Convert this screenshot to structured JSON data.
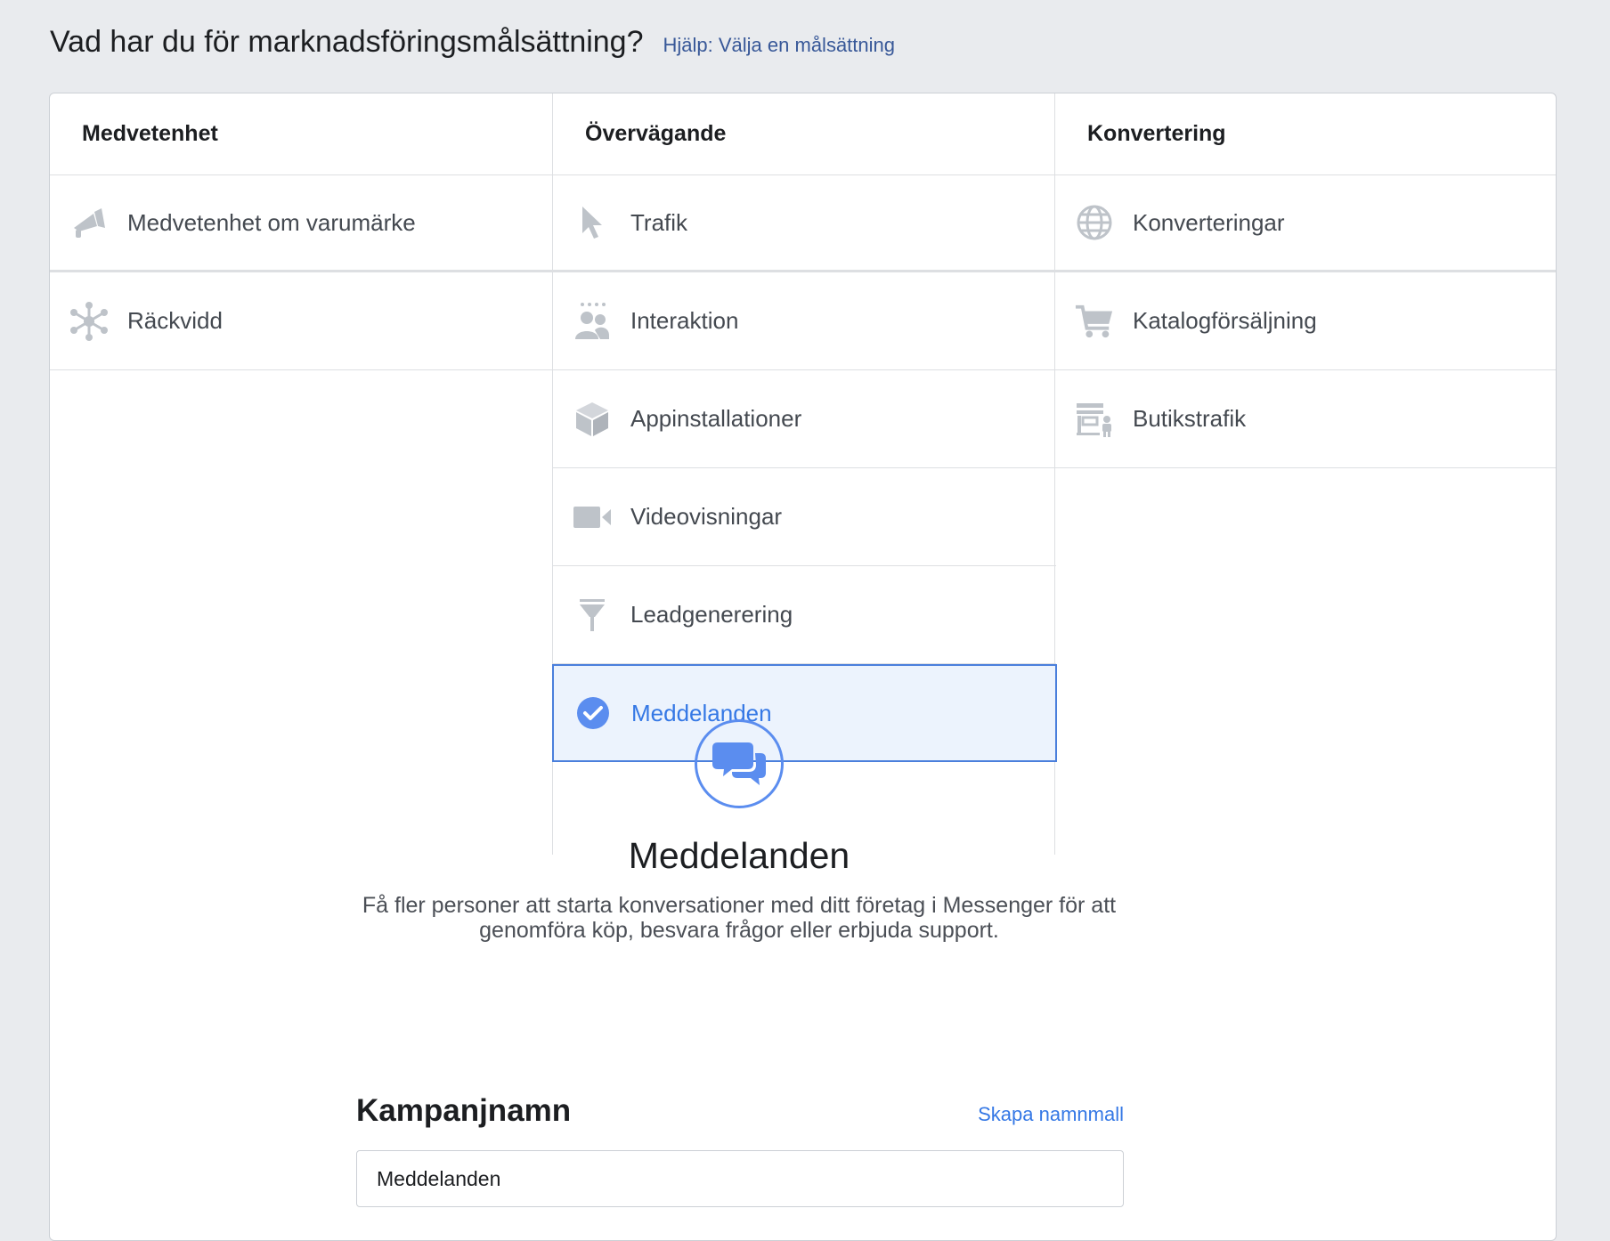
{
  "header": {
    "title": "Vad har du för marknadsföringsmålsättning?",
    "help_link": "Hjälp: Välja en målsättning"
  },
  "columns": [
    {
      "title": "Medvetenhet",
      "items": [
        {
          "label": "Medvetenhet om varumärke",
          "icon": "megaphone-icon"
        },
        {
          "label": "Räckvidd",
          "icon": "reach-icon"
        }
      ]
    },
    {
      "title": "Övervägande",
      "items": [
        {
          "label": "Trafik",
          "icon": "cursor-icon"
        },
        {
          "label": "Interaktion",
          "icon": "people-icon"
        },
        {
          "label": "Appinstallationer",
          "icon": "box-icon"
        },
        {
          "label": "Videovisningar",
          "icon": "video-camera-icon"
        },
        {
          "label": "Leadgenerering",
          "icon": "funnel-icon"
        },
        {
          "label": "Meddelanden",
          "icon": "check-circle-icon",
          "selected": true
        }
      ]
    },
    {
      "title": "Konvertering",
      "items": [
        {
          "label": "Konverteringar",
          "icon": "globe-icon"
        },
        {
          "label": "Katalogförsäljning",
          "icon": "cart-icon"
        },
        {
          "label": "Butikstrafik",
          "icon": "store-icon"
        }
      ]
    }
  ],
  "detail": {
    "icon": "chat-bubbles-icon",
    "title": "Meddelanden",
    "description": "Få fler personer att starta konversationer med ditt företag i Messenger för att genomföra köp, besvara frågor eller erbjuda support."
  },
  "campaign": {
    "title": "Kampanjnamn",
    "template_link": "Skapa namnmall",
    "value": "Meddelanden"
  },
  "colors": {
    "accent": "#3578e5",
    "selected_bg": "#ecf3fd",
    "icon_gray": "#bec3c9",
    "link": "#385898"
  }
}
